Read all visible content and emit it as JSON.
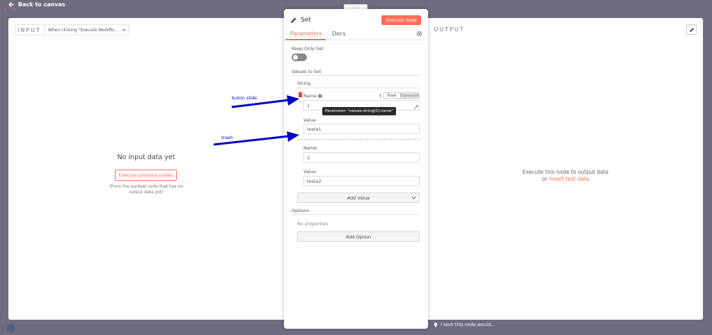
{
  "topbar": {
    "back_label": "Back to canvas"
  },
  "input_panel": {
    "label": "INPUT",
    "trigger_select": "When clicking \"Execute Workflo...",
    "empty_title": "No input data yet",
    "exec_prev_label": "Execute previous nodes",
    "empty_note": "(From the earliest node that has no output data yet)"
  },
  "output_panel": {
    "label": "OUTPUT",
    "msg_line1": "Execute this node to output data",
    "msg_or": "or",
    "msg_link": "insert test data"
  },
  "node": {
    "drag_handle": "::::",
    "title": "Set",
    "exec_label": "Execute node",
    "tabs": [
      "Parameters",
      "Docs"
    ],
    "keep_only_set_label": "Keep Only Set",
    "keep_only_set_value": false,
    "values_to_set_label": "Values to Set",
    "string_label": "String",
    "items": [
      {
        "name_label": "Name",
        "name_value": "1",
        "value_label": "Value",
        "value_value": "teste1"
      },
      {
        "name_label": "Name",
        "name_value": "2",
        "value_label": "Value",
        "value_value": "teste2"
      }
    ],
    "fixed_label": "Fixed",
    "expression_label": "Expression",
    "tooltip": "Parameter: \"values.string[0].name\"",
    "add_value_label": "Add Value",
    "options_label": "Options",
    "no_properties": "No properties",
    "add_option_label": "Add Option",
    "help_glyph": "?"
  },
  "annotations": {
    "button_slide": "buton slide",
    "trash": "trash"
  },
  "feedback": {
    "label": "I wish this node would..."
  },
  "colors": {
    "accent": "#ff6d5a",
    "backdrop": "#6f6c80",
    "annotation_blue": "#0000c8"
  }
}
